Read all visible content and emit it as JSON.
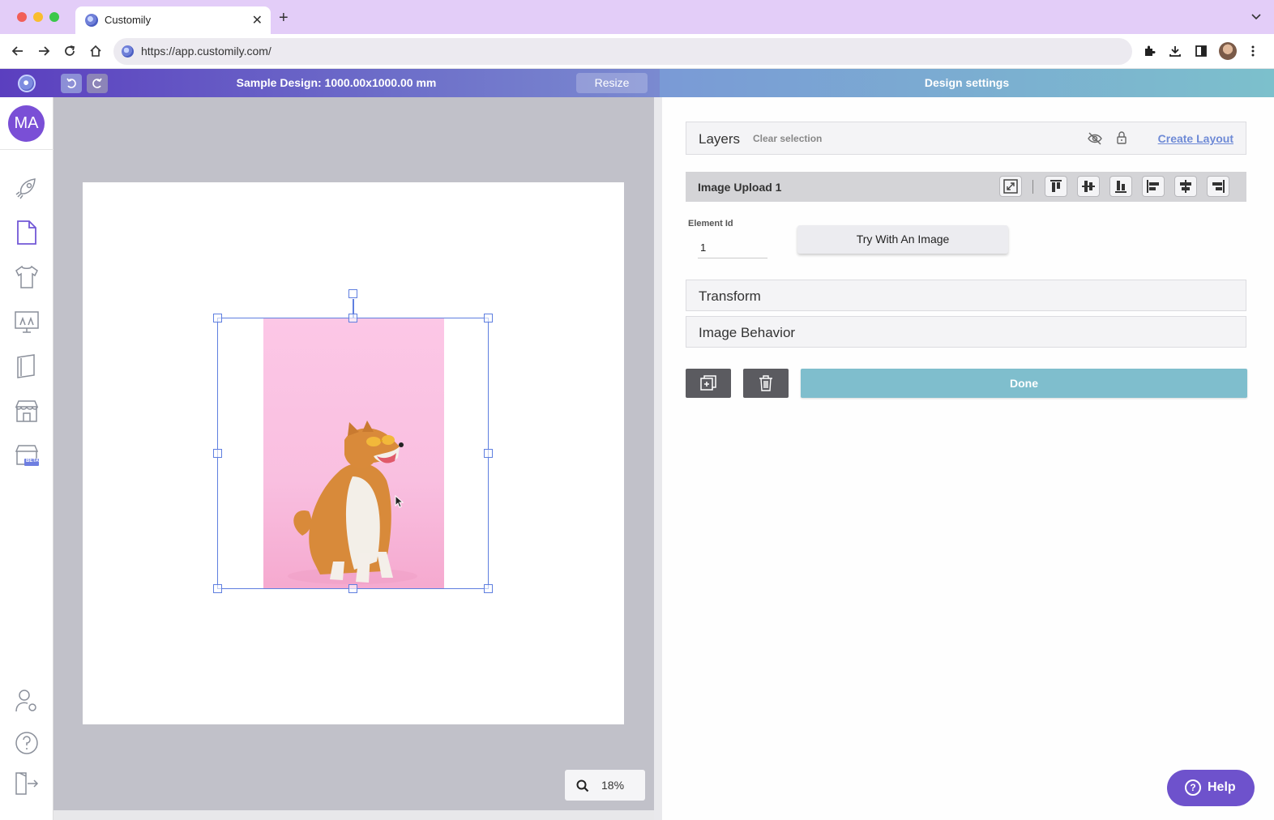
{
  "browser": {
    "tab_title": "Customily",
    "tab_close": "✕",
    "new_tab": "+",
    "url": "https://app.customily.com/"
  },
  "header": {
    "design_title": "Sample Design: 1000.00x1000.00 mm",
    "resize_label": "Resize",
    "undo_icon": "undo-icon",
    "redo_icon": "redo-icon",
    "settings_title": "Design settings"
  },
  "sidebar": {
    "avatar_initials": "MA",
    "items": [
      "rocket-icon",
      "page-icon",
      "tshirt-icon",
      "mockup-icon",
      "book-icon",
      "store-icon",
      "store-beta-icon",
      "user-settings-icon",
      "help-circle-icon",
      "logout-icon"
    ],
    "beta_label": "BETA"
  },
  "canvas": {
    "zoom": "18%"
  },
  "panel": {
    "layers_title": "Layers",
    "clear_selection": "Clear selection",
    "create_layout": "Create Layout",
    "element_title": "Image Upload 1",
    "element_id_label": "Element Id",
    "element_id_value": "1",
    "try_with_image": "Try With An Image",
    "sections": [
      "Transform",
      "Image Behavior"
    ],
    "done_label": "Done"
  },
  "help": {
    "label": "Help"
  },
  "colors": {
    "accent_purple": "#6e52cc",
    "done_teal": "#7fbecd",
    "selection_blue": "#5f7fe0"
  }
}
